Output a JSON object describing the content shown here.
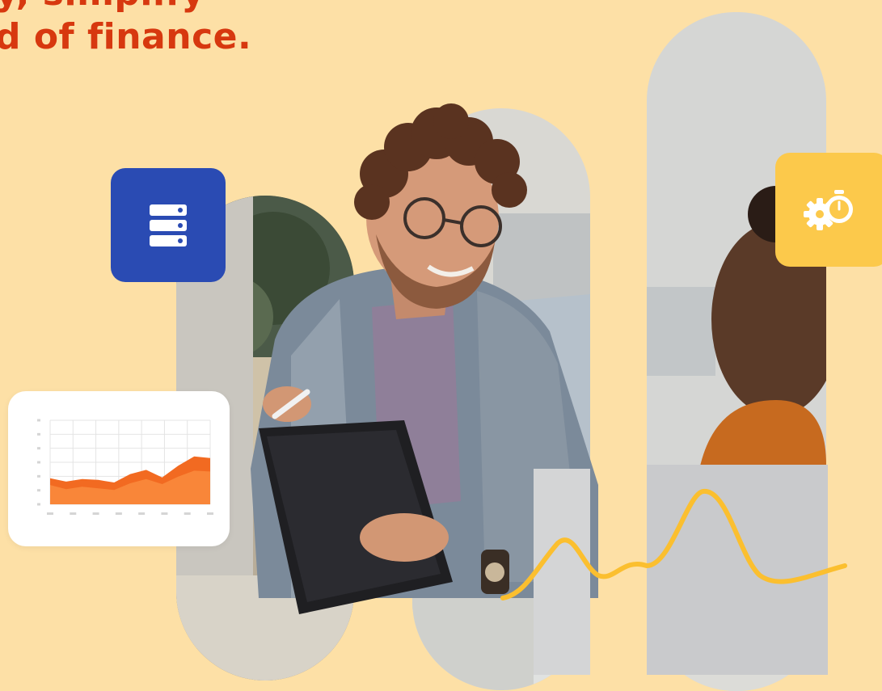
{
  "headline": {
    "line_1": "y, simplify",
    "line_2": "d of finance."
  },
  "icons": {
    "server": "server-stack-icon",
    "gear_timer": "gear-stopwatch-icon",
    "chart": "area-chart-icon"
  },
  "colors": {
    "background": "#fde0a6",
    "headline": "#d7380f",
    "server_tile": "#2a4bb3",
    "gear_tile": "#fcc94b",
    "chart_fill": "#f26a21",
    "squiggle": "#fbbf2f"
  },
  "chart_data": {
    "type": "area",
    "x": [
      0,
      1,
      2,
      3,
      4,
      5,
      6,
      7,
      8,
      9,
      10
    ],
    "series": [
      {
        "values": [
          31,
          27,
          30,
          29,
          26,
          36,
          41,
          32,
          46,
          57,
          55
        ]
      },
      {
        "values": [
          23,
          18,
          21,
          19,
          17,
          25,
          30,
          24,
          33,
          40,
          39
        ]
      }
    ],
    "ylim": [
      0,
      100
    ],
    "grid": true
  }
}
